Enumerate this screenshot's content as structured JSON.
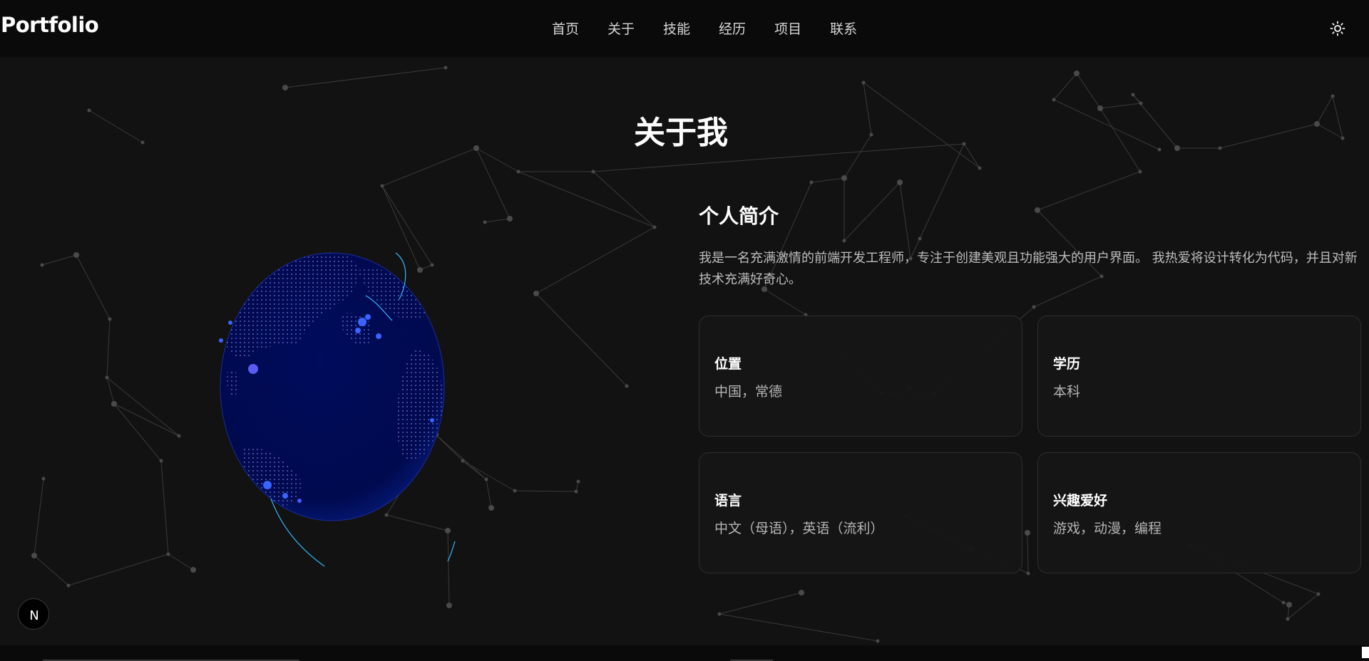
{
  "header": {
    "logo": "Portfolio",
    "nav": [
      "首页",
      "关于",
      "技能",
      "经历",
      "项目",
      "联系"
    ],
    "theme_toggle_icon": "sun-icon"
  },
  "about": {
    "title": "关于我",
    "profile_heading": "个人简介",
    "profile_text": "我是一名充满激情的前端开发工程师，专注于创建美观且功能强大的用户界面。 我热爱将设计转化为代码，并且对新技术充满好奇心。",
    "cards": [
      {
        "label": "位置",
        "value": "中国，常德"
      },
      {
        "label": "学历",
        "value": "本科"
      },
      {
        "label": "语言",
        "value": "中文（母语），英语（流利）"
      },
      {
        "label": "兴趣爱好",
        "value": "游戏，动漫，编程"
      }
    ]
  },
  "badge": {
    "icon": "nextjs-icon",
    "letter": "N"
  },
  "colors": {
    "background": "#121212",
    "header": "#0a0a0a",
    "card_border": "#2e2e2e",
    "globe": "#000a52",
    "globe_highlight": "#2f6bff"
  }
}
